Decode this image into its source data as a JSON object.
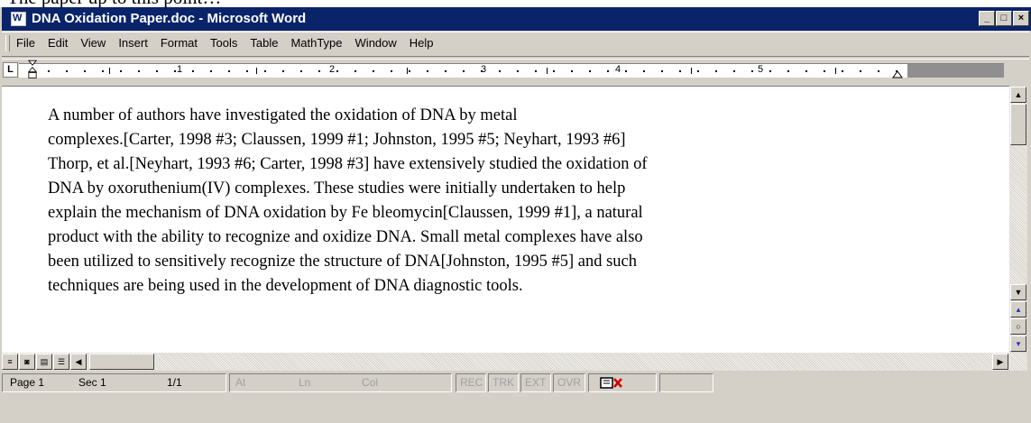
{
  "caption": "The paper up to this point…",
  "window": {
    "title": "DNA Oxidation Paper.doc - Microsoft Word",
    "controls": [
      "_",
      "□",
      "×"
    ]
  },
  "menu": [
    "File",
    "Edit",
    "View",
    "Insert",
    "Format",
    "Tools",
    "Table",
    "MathType",
    "Window",
    "Help"
  ],
  "ruler": {
    "tab_selector": "L",
    "numbers": [
      "1",
      "2",
      "3",
      "4",
      "5"
    ]
  },
  "document": {
    "lines": [
      "A number of authors have investigated the oxidation of DNA by metal",
      "complexes.[Carter, 1998 #3; Claussen, 1999 #1; Johnston, 1995 #5; Neyhart, 1993 #6]",
      "Thorp, et al.[Neyhart, 1993 #6; Carter, 1998 #3] have extensively studied the oxidation of",
      "DNA by oxoruthenium(IV) complexes.  These studies were initially undertaken to help",
      "explain the mechanism of DNA oxidation by Fe bleomycin[Claussen, 1999 #1], a natural",
      "product with the ability to recognize and oxidize DNA.  Small metal complexes have also",
      "been utilized to sensitively recognize the structure of DNA[Johnston, 1995 #5] and such",
      "techniques are being used in the development of DNA diagnostic tools."
    ]
  },
  "statusbar": {
    "page": "Page 1",
    "sec": "Sec 1",
    "pages": "1/1",
    "at": "At",
    "ln": "Ln",
    "col": "Col",
    "rec": "REC",
    "trk": "TRK",
    "ext": "EXT",
    "ovr": "OVR"
  }
}
